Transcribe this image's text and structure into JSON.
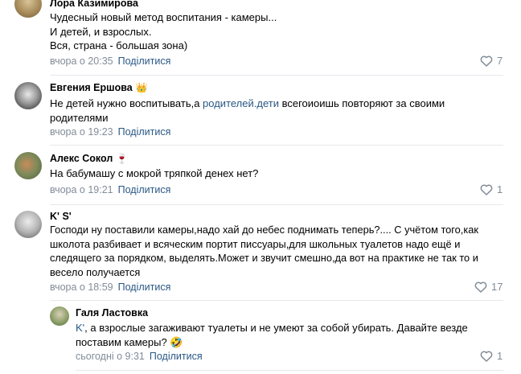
{
  "colors": {
    "link": "#2a5885",
    "meta": "#818c99",
    "divider": "#e7e8ec"
  },
  "share_label": "Поділитися",
  "comments": [
    {
      "author": "Лора Казимирова",
      "author_emoji": "",
      "text": "Чудесный новый метод воспитания - камеры...\nИ детей, и взрослых.\nВся, страна - большая зона)",
      "time": "вчора о 20:35",
      "likes": "7",
      "avatar_icon": "profile-photo"
    },
    {
      "author": "Евгения Ершова",
      "author_emoji": "👑",
      "text_before": "Не детей нужно воспитывать,а ",
      "text_link": "родителей.дети",
      "text_after": " всегоиоишь повторяют за своими родителями",
      "time": "вчора о 19:23",
      "likes": "",
      "avatar_icon": "profile-photo"
    },
    {
      "author": "Алекс Сокол",
      "author_emoji": "🍷",
      "text": "На бабумашу с мокрой тряпкой денех нет?",
      "time": "вчора о 19:21",
      "likes": "1",
      "avatar_icon": "profile-photo"
    },
    {
      "author": "K' S'",
      "author_emoji": "",
      "text": "Господи ну поставили камеры,надо хай до небес поднимать теперь?.... С учётом того,как школота разбивает и всяческим портит писсуары,для школьных туалетов надо ещё и следящего за порядком, выделять.Может и звучит смешно,да вот на практике не так то и весело получается",
      "time": "вчора о 18:59",
      "likes": "17",
      "avatar_icon": "profile-photo"
    }
  ],
  "reply": {
    "author": "Галя Ластовка",
    "mention": "K'",
    "text": ", а взрослые загаживают туалеты и не умеют за собой убирать. Давайте везде поставим камеры? 🤣",
    "time": "сьогодні о 9:31",
    "likes": "1",
    "avatar_icon": "profile-photo"
  }
}
